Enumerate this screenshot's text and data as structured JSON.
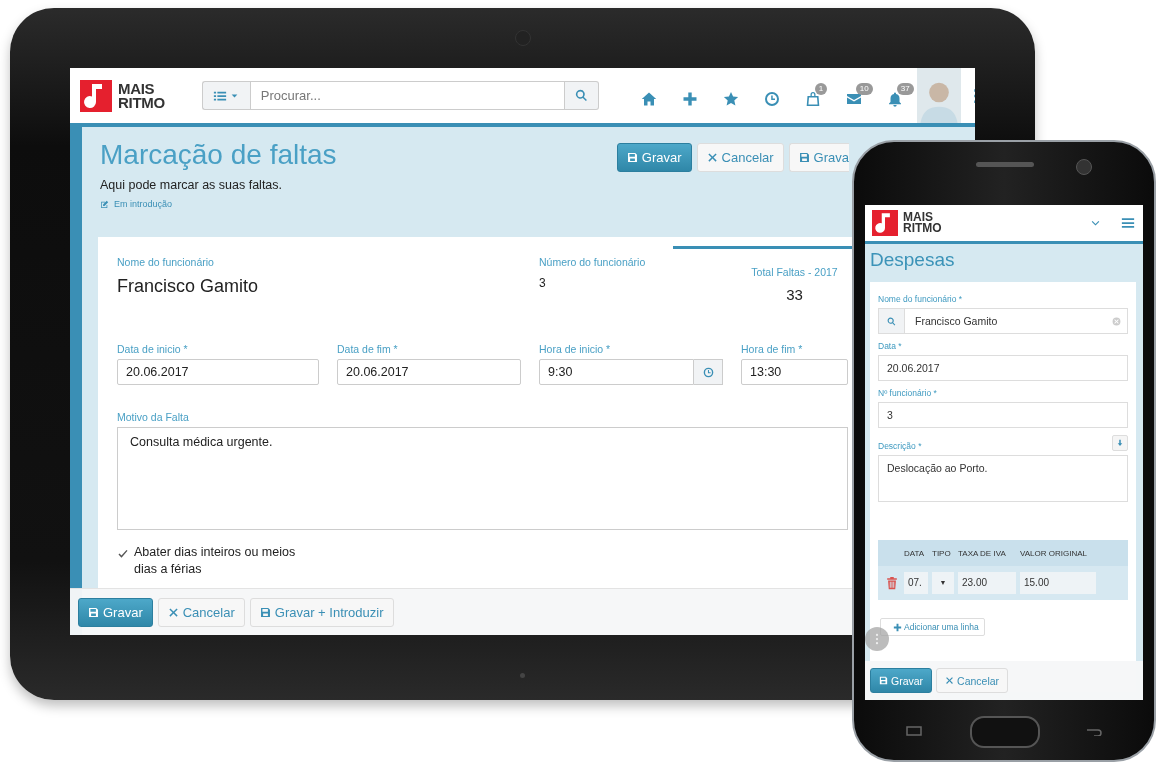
{
  "tablet": {
    "navbar": {
      "logo": "MAIS RITMO",
      "search": {
        "placeholder": "Procurar..."
      },
      "icons": [
        {
          "kind": "home"
        },
        {
          "kind": "plus"
        },
        {
          "kind": "star"
        },
        {
          "kind": "clock"
        },
        {
          "kind": "bag",
          "badge": "1"
        },
        {
          "kind": "mail",
          "badge": "10"
        },
        {
          "kind": "bell",
          "badge": "37"
        }
      ]
    },
    "header": {
      "title": "Marcação de faltas",
      "subtitle": "Aqui pode marcar as suas faltas.",
      "status": "Em introdução",
      "buttons": [
        {
          "kind": "save",
          "label": "Gravar",
          "primary": true
        },
        {
          "kind": "cancel",
          "label": "Cancelar",
          "primary": false
        },
        {
          "kind": "save",
          "label": "Grava",
          "primary": false
        }
      ]
    },
    "form": {
      "employee_name": {
        "label": "Nome do funcionário",
        "value": "Francisco Gamito"
      },
      "employee_number": {
        "label": "Número do funcionário",
        "value": "3"
      },
      "total": {
        "label": "Total Faltas - 2017",
        "value": "33"
      },
      "fields": [
        {
          "kind": "text",
          "label": "Data de inicio *",
          "value": "20.06.2017"
        },
        {
          "kind": "text",
          "label": "Data de fim *",
          "value": "20.06.2017"
        },
        {
          "kind": "time",
          "label": "Hora de inicio *",
          "value": "9:30"
        },
        {
          "kind": "text",
          "label": "Hora de fim *",
          "value": "13:30"
        }
      ],
      "reason": {
        "label": "Motivo da Falta",
        "value": "Consulta médica urgente."
      },
      "deduct": {
        "label": "Abater dias inteiros ou meios dias a férias",
        "checked": true
      }
    },
    "footer_buttons": [
      {
        "kind": "save",
        "label": "Gravar",
        "primary": true
      },
      {
        "kind": "cancel",
        "label": "Cancelar",
        "primary": false
      },
      {
        "kind": "save",
        "label": "Gravar + Introduzir",
        "primary": false
      }
    ]
  },
  "phone": {
    "navbar": {
      "logo": "MAIS RITMO"
    },
    "title": "Despesas",
    "fields": [
      {
        "kind": "search",
        "label": "Nome do funcionário *",
        "value": "Francisco Gamito"
      },
      {
        "kind": "text",
        "label": "Data *",
        "value": "20.06.2017"
      },
      {
        "kind": "text",
        "label": "Nº funcionário *",
        "value": "3"
      },
      {
        "kind": "textarea",
        "label": "Descrição *",
        "value": "Deslocação ao Porto."
      }
    ],
    "table": {
      "columns": [
        "DATA",
        "TIPO",
        "TAXA DE IVA",
        "VALOR ORIGINAL"
      ],
      "rows": [
        {
          "cells": [
            "07.",
            "▼",
            "23.00",
            "15.00"
          ]
        }
      ]
    },
    "add_line": "Adicionar uma linha",
    "buttons": [
      {
        "kind": "save",
        "label": "Gravar",
        "primary": true
      },
      {
        "kind": "cancel",
        "label": "Cancelar",
        "primary": false
      }
    ]
  }
}
